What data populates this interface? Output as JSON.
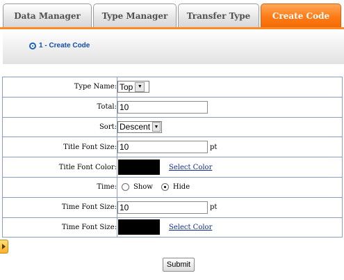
{
  "tabs": [
    {
      "label": "Data Manager",
      "active": false
    },
    {
      "label": "Type Manager",
      "active": false
    },
    {
      "label": "Transfer Type",
      "active": false
    },
    {
      "label": "Create Code",
      "active": true
    }
  ],
  "step": {
    "label": "1 - Create Code"
  },
  "form": {
    "type_name": {
      "label": "Type Name:",
      "value": "Top"
    },
    "total": {
      "label": "Total:",
      "value": "10"
    },
    "sort": {
      "label": "Sort:",
      "value": "Descent"
    },
    "title_font_size": {
      "label": "Title Font Size:",
      "value": "10",
      "unit": "pt"
    },
    "title_font_color": {
      "label": "Title Font Color:",
      "color": "#000000",
      "link": "Select Color"
    },
    "time": {
      "label": "Time:",
      "options": [
        "Show",
        "Hide"
      ],
      "selected": "Hide"
    },
    "time_font_size": {
      "label": "Time Font Size:",
      "value": "10",
      "unit": "pt"
    },
    "time_font_color": {
      "label": "Time Font Size:",
      "color": "#000000",
      "link": "Select Color"
    }
  },
  "submit_label": "Submit",
  "colors": {
    "accent": "#ff7a14",
    "tab_text": "#505050",
    "link": "#0b2a8a",
    "border": "#8b9ec2"
  }
}
